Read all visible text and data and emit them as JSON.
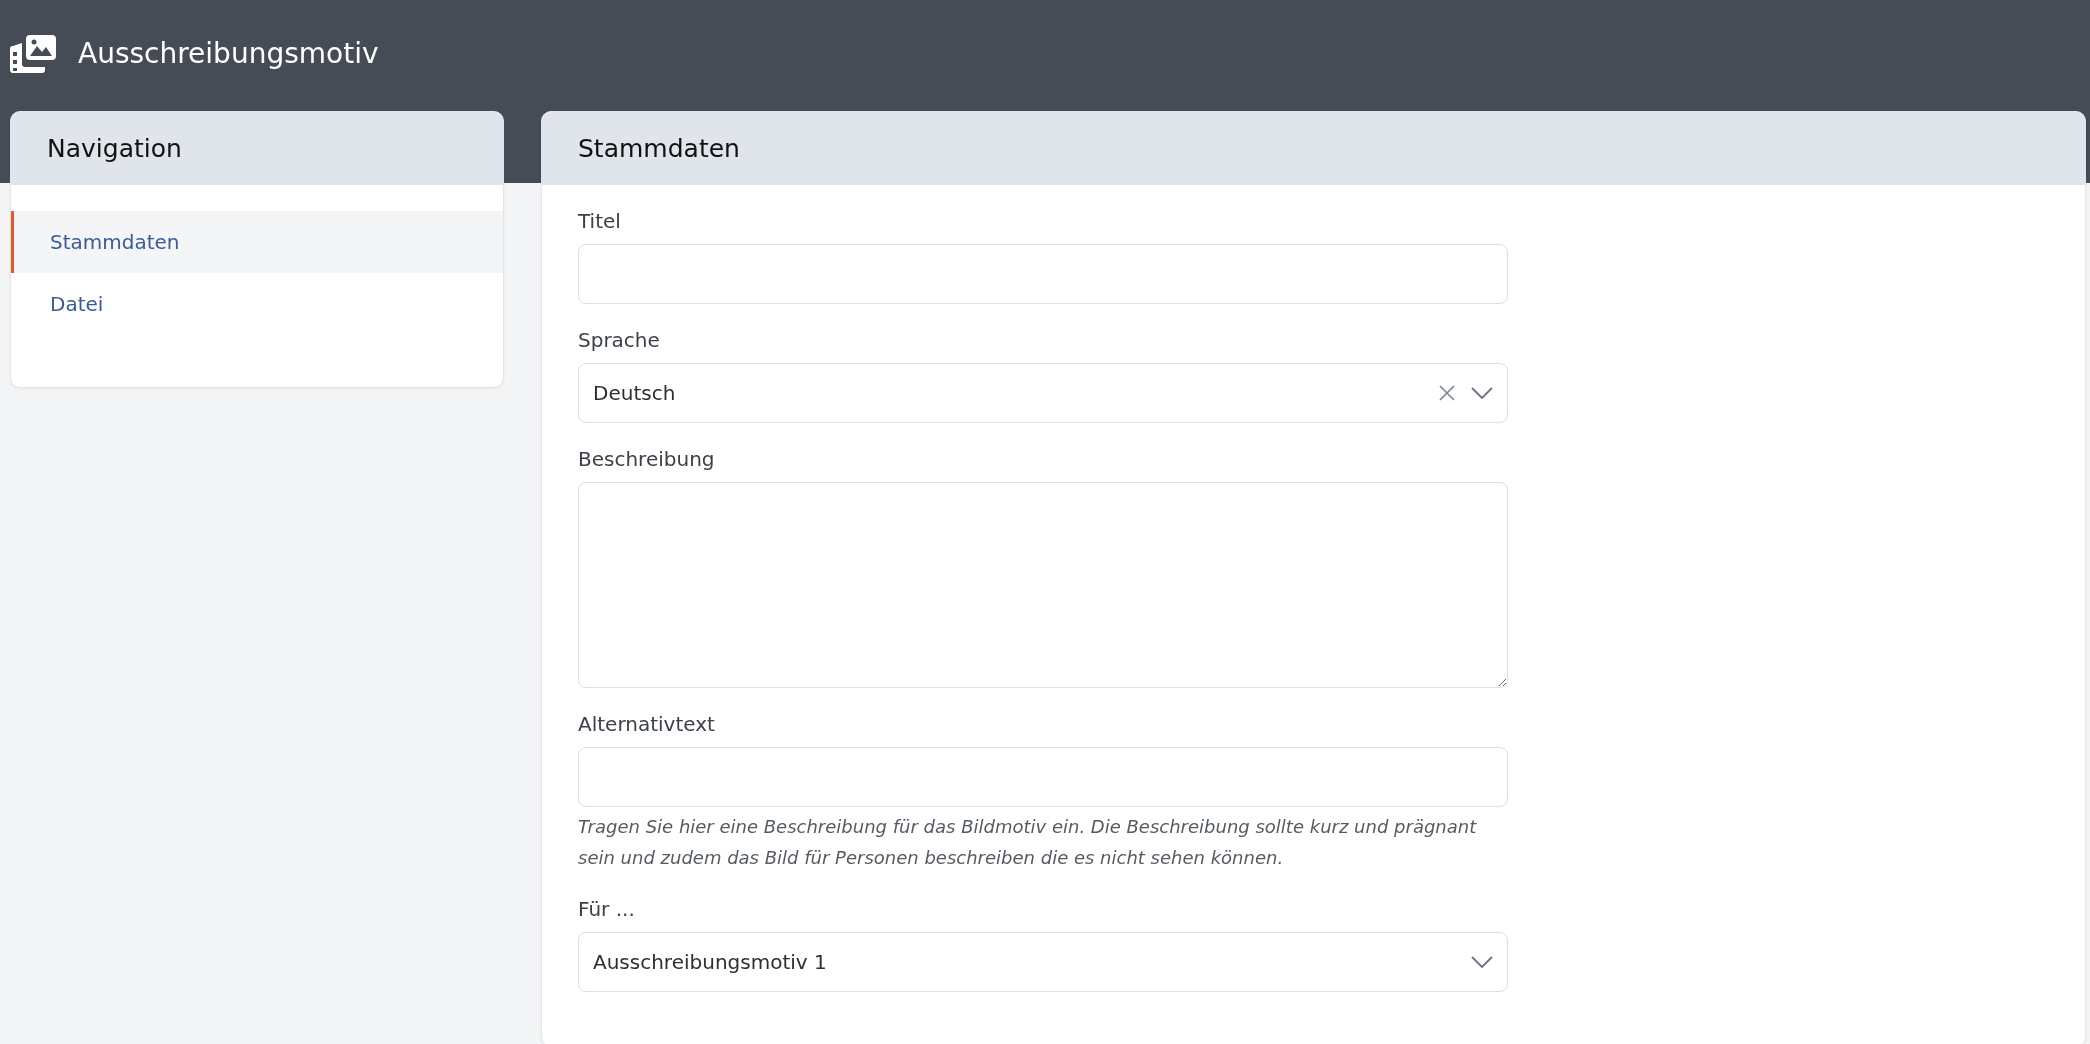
{
  "header": {
    "title": "Ausschreibungsmotiv"
  },
  "navigation": {
    "title": "Navigation",
    "items": [
      {
        "label": "Stammdaten",
        "selected": true
      },
      {
        "label": "Datei",
        "selected": false
      }
    ]
  },
  "form": {
    "title": "Stammdaten",
    "fields": [
      {
        "kind": "text",
        "label": "Titel"
      },
      {
        "kind": "select",
        "label": "Sprache",
        "value": "Deutsch",
        "clearable": true
      },
      {
        "kind": "textarea",
        "label": "Beschreibung"
      },
      {
        "kind": "text",
        "label": "Alternativtext",
        "help": "Tragen Sie hier eine Beschreibung für das Bildmotiv ein. Die Beschreibung sollte kurz und prägnant sein und zudem das Bild für Personen beschreiben die es nicht sehen können."
      },
      {
        "kind": "select",
        "label": "Für ...",
        "value": "Ausschreibungsmotiv 1",
        "clearable": false
      }
    ]
  }
}
